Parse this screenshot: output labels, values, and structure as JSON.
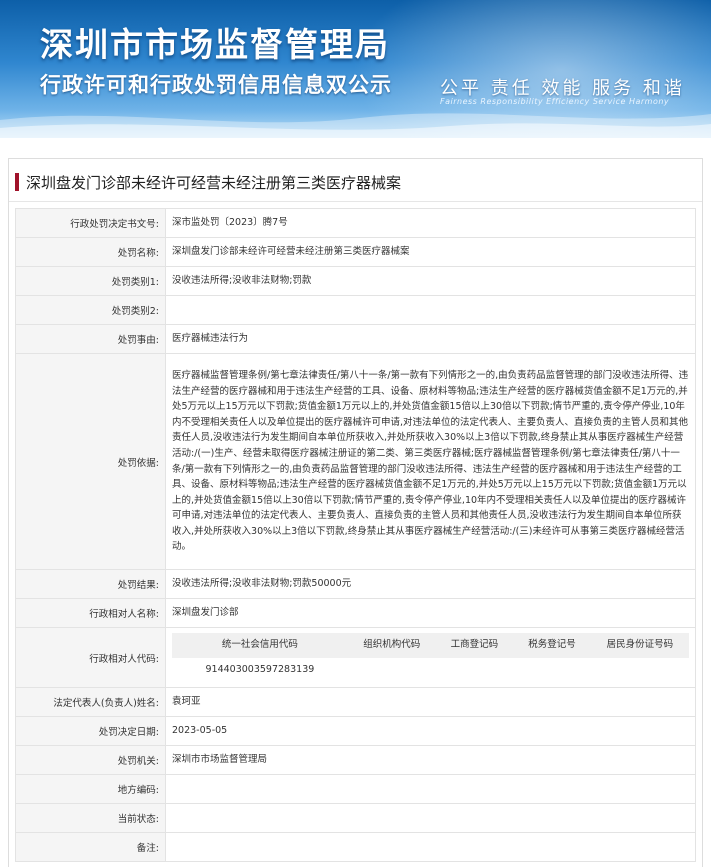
{
  "banner": {
    "title": "深圳市市场监督管理局",
    "subtitle": "行政许可和行政处罚信用信息双公示",
    "slogan": "公平  责任  效能  服务  和谐",
    "slogan_en": "Fairness  Responsibility  Efficiency  Service  Harmony"
  },
  "page": {
    "title": "深圳盘发门诊部未经许可经营未经注册第三类医疗器械案"
  },
  "fields": {
    "doc_no": {
      "label": "行政处罚决定书文号:",
      "value": "深市监处罚〔2023〕腾7号"
    },
    "case_name": {
      "label": "处罚名称:",
      "value": "深圳盘发门诊部未经许可经营未经注册第三类医疗器械案"
    },
    "category1": {
      "label": "处罚类别1:",
      "value": "没收违法所得;没收非法财物;罚款"
    },
    "category2": {
      "label": "处罚类别2:",
      "value": ""
    },
    "reason": {
      "label": "处罚事由:",
      "value": "医疗器械违法行为"
    },
    "basis": {
      "label": "处罚依据:",
      "value": "医疗器械监督管理条例/第七章法律责任/第八十一条/第一款有下列情形之一的,由负责药品监督管理的部门没收违法所得、违法生产经营的医疗器械和用于违法生产经营的工具、设备、原材料等物品;违法生产经营的医疗器械货值金额不足1万元的,并处5万元以上15万元以下罚款;货值金额1万元以上的,并处货值金额15倍以上30倍以下罚款;情节严重的,责令停产停业,10年内不受理相关责任人以及单位提出的医疗器械许可申请,对违法单位的法定代表人、主要负责人、直接负责的主管人员和其他责任人员,没收违法行为发生期间自本单位所获收入,并处所获收入30%以上3倍以下罚款,终身禁止其从事医疗器械生产经营活动:/(一)生产、经营未取得医疗器械注册证的第二类、第三类医疗器械;医疗器械监督管理条例/第七章法律责任/第八十一条/第一款有下列情形之一的,由负责药品监督管理的部门没收违法所得、违法生产经营的医疗器械和用于违法生产经营的工具、设备、原材料等物品;违法生产经营的医疗器械货值金额不足1万元的,并处5万元以上15万元以下罚款;货值金额1万元以上的,并处货值金额15倍以上30倍以下罚款;情节严重的,责令停产停业,10年内不受理相关责任人以及单位提出的医疗器械许可申请,对违法单位的法定代表人、主要负责人、直接负责的主管人员和其他责任人员,没收违法行为发生期间自本单位所获收入,并处所获收入30%以上3倍以下罚款,终身禁止其从事医疗器械生产经营活动:/(三)未经许可从事第三类医疗器械经营活动。"
    },
    "result": {
      "label": "处罚结果:",
      "value": "没收违法所得;没收非法财物;罚款50000元"
    },
    "party_name": {
      "label": "行政相对人名称:",
      "value": "深圳盘发门诊部"
    },
    "party_code": {
      "label": "行政相对人代码:",
      "headers": [
        "统一社会信用代码",
        "组织机构代码",
        "工商登记码",
        "税务登记号",
        "居民身份证号码"
      ],
      "values": [
        "914403003597283139",
        "",
        "",
        "",
        ""
      ]
    },
    "legal_rep": {
      "label": "法定代表人(负责人)姓名:",
      "value": "袁珂亚"
    },
    "date": {
      "label": "处罚决定日期:",
      "value": "2023-05-05"
    },
    "authority": {
      "label": "处罚机关:",
      "value": "深圳市市场监督管理局"
    },
    "area_code": {
      "label": "地方编码:",
      "value": ""
    },
    "status": {
      "label": "当前状态:",
      "value": ""
    },
    "remark": {
      "label": "备注:",
      "value": ""
    }
  },
  "colors": {
    "banner_top": "#0d5fa8",
    "title_accent": "#a0122a",
    "label_bg": "#f5f5f5"
  }
}
